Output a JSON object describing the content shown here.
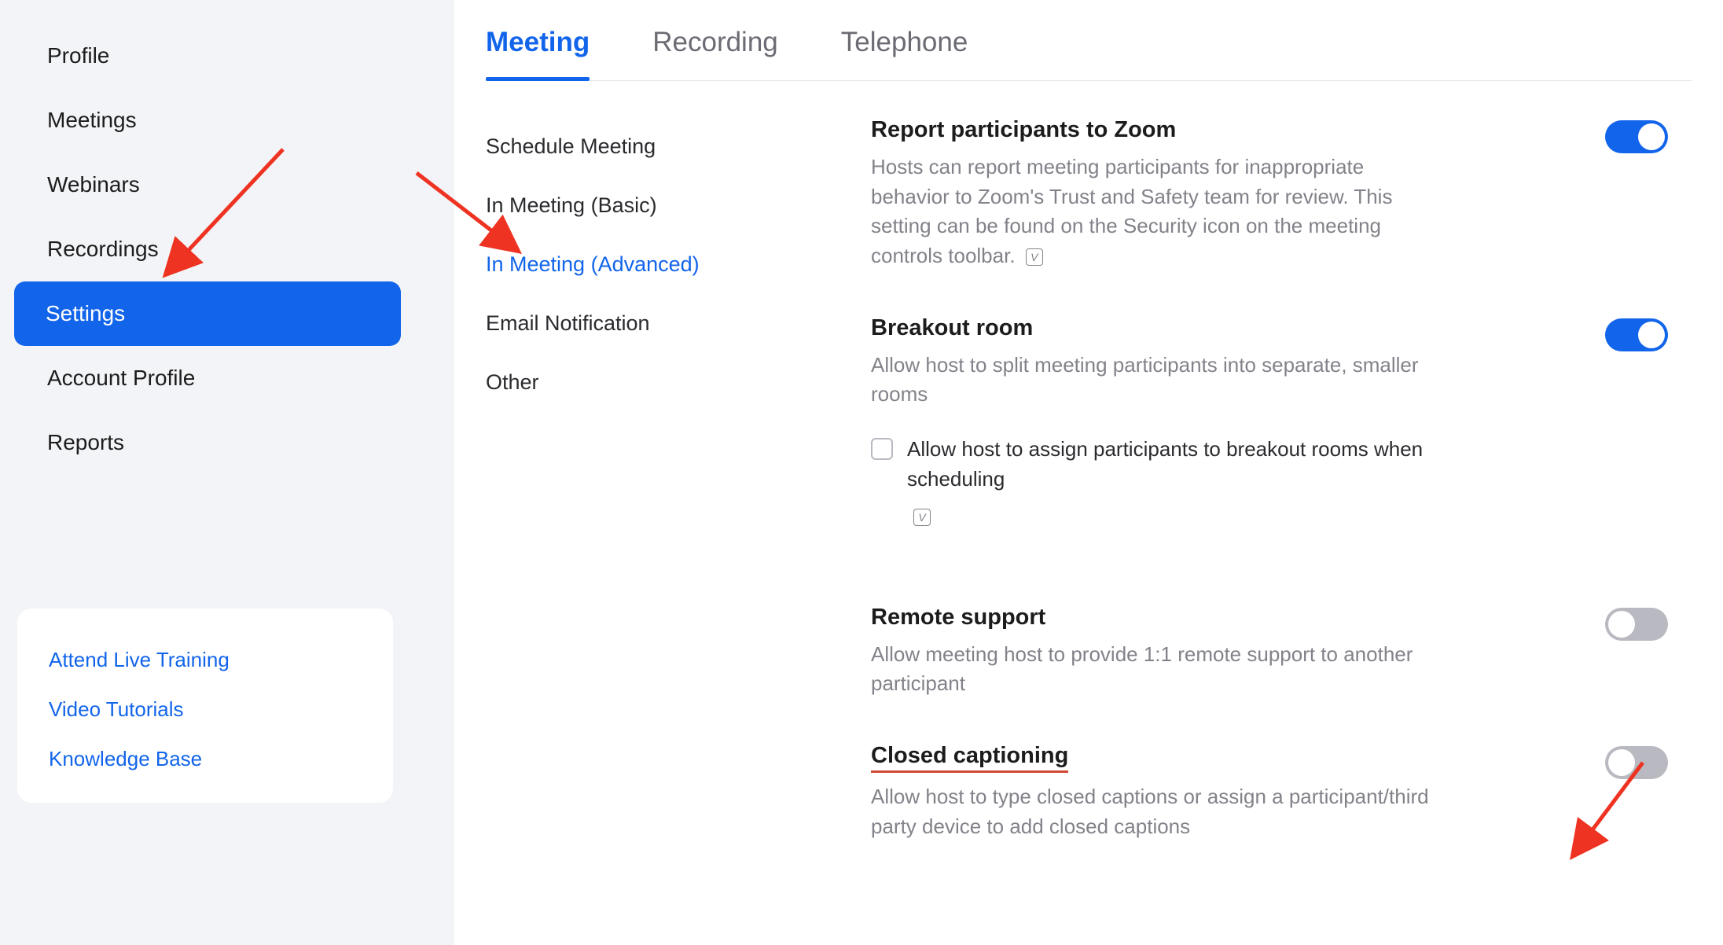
{
  "sidebar": {
    "items": [
      {
        "label": "Profile",
        "active": false
      },
      {
        "label": "Meetings",
        "active": false
      },
      {
        "label": "Webinars",
        "active": false
      },
      {
        "label": "Recordings",
        "active": false
      },
      {
        "label": "Settings",
        "active": true
      },
      {
        "label": "Account Profile",
        "active": false
      },
      {
        "label": "Reports",
        "active": false
      }
    ],
    "help": [
      {
        "label": "Attend Live Training"
      },
      {
        "label": "Video Tutorials"
      },
      {
        "label": "Knowledge Base"
      }
    ]
  },
  "tabs": [
    {
      "label": "Meeting",
      "active": true
    },
    {
      "label": "Recording",
      "active": false
    },
    {
      "label": "Telephone",
      "active": false
    }
  ],
  "subnav": [
    {
      "label": "Schedule Meeting",
      "active": false
    },
    {
      "label": "In Meeting (Basic)",
      "active": false
    },
    {
      "label": "In Meeting (Advanced)",
      "active": true
    },
    {
      "label": "Email Notification",
      "active": false
    },
    {
      "label": "Other",
      "active": false
    }
  ],
  "settings": {
    "report": {
      "title": "Report participants to Zoom",
      "desc": "Hosts can report meeting participants for inappropriate behavior to Zoom's Trust and Safety team for review. This setting can be found on the Security icon on the meeting controls toolbar.",
      "badge": "V",
      "on": true
    },
    "breakout": {
      "title": "Breakout room",
      "desc": "Allow host to split meeting participants into separate, smaller rooms",
      "checkbox_label": "Allow host to assign participants to breakout rooms when scheduling",
      "badge": "V",
      "on": true
    },
    "remote": {
      "title": "Remote support",
      "desc": "Allow meeting host to provide 1:1 remote support to another participant",
      "on": false
    },
    "caption": {
      "title": "Closed captioning",
      "desc": "Allow host to type closed captions or assign a participant/third party device to add closed captions",
      "on": false
    }
  }
}
